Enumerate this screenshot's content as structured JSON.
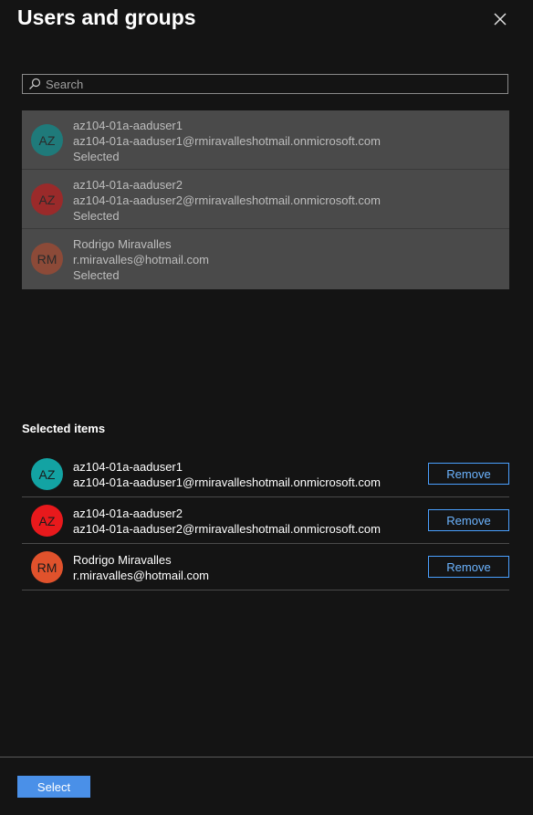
{
  "panel": {
    "title": "Users and groups",
    "close_icon": "close-icon"
  },
  "search": {
    "placeholder": "Search",
    "value": "",
    "icon": "search-icon"
  },
  "results": [
    {
      "initials": "AZ",
      "name": "az104-01a-aaduser1",
      "email": "az104-01a-aaduser1@rmiravalleshotmail.onmicrosoft.com",
      "status": "Selected",
      "avatar_color": "#1f7a7a"
    },
    {
      "initials": "AZ",
      "name": "az104-01a-aaduser2",
      "email": "az104-01a-aaduser2@rmiravalleshotmail.onmicrosoft.com",
      "status": "Selected",
      "avatar_color": "#9a2a2a"
    },
    {
      "initials": "RM",
      "name": "Rodrigo Miravalles",
      "email": "r.miravalles@hotmail.com",
      "status": "Selected",
      "avatar_color": "#8c4a38"
    }
  ],
  "selected_items": {
    "label": "Selected items",
    "items": [
      {
        "initials": "AZ",
        "name": "az104-01a-aaduser1",
        "email": "az104-01a-aaduser1@rmiravalleshotmail.onmicrosoft.com",
        "remove_label": "Remove",
        "avatar_color": "#13a3a3"
      },
      {
        "initials": "AZ",
        "name": "az104-01a-aaduser2",
        "email": "az104-01a-aaduser2@rmiravalleshotmail.onmicrosoft.com",
        "remove_label": "Remove",
        "avatar_color": "#e8191c"
      },
      {
        "initials": "RM",
        "name": "Rodrigo Miravalles",
        "email": "r.miravalles@hotmail.com",
        "remove_label": "Remove",
        "avatar_color": "#e0522c"
      }
    ]
  },
  "footer": {
    "select_label": "Select"
  },
  "colors": {
    "background": "#141414",
    "accent": "#4a90e8",
    "link": "#6cb4ff",
    "result_row_bg": "#4a4a4a"
  }
}
